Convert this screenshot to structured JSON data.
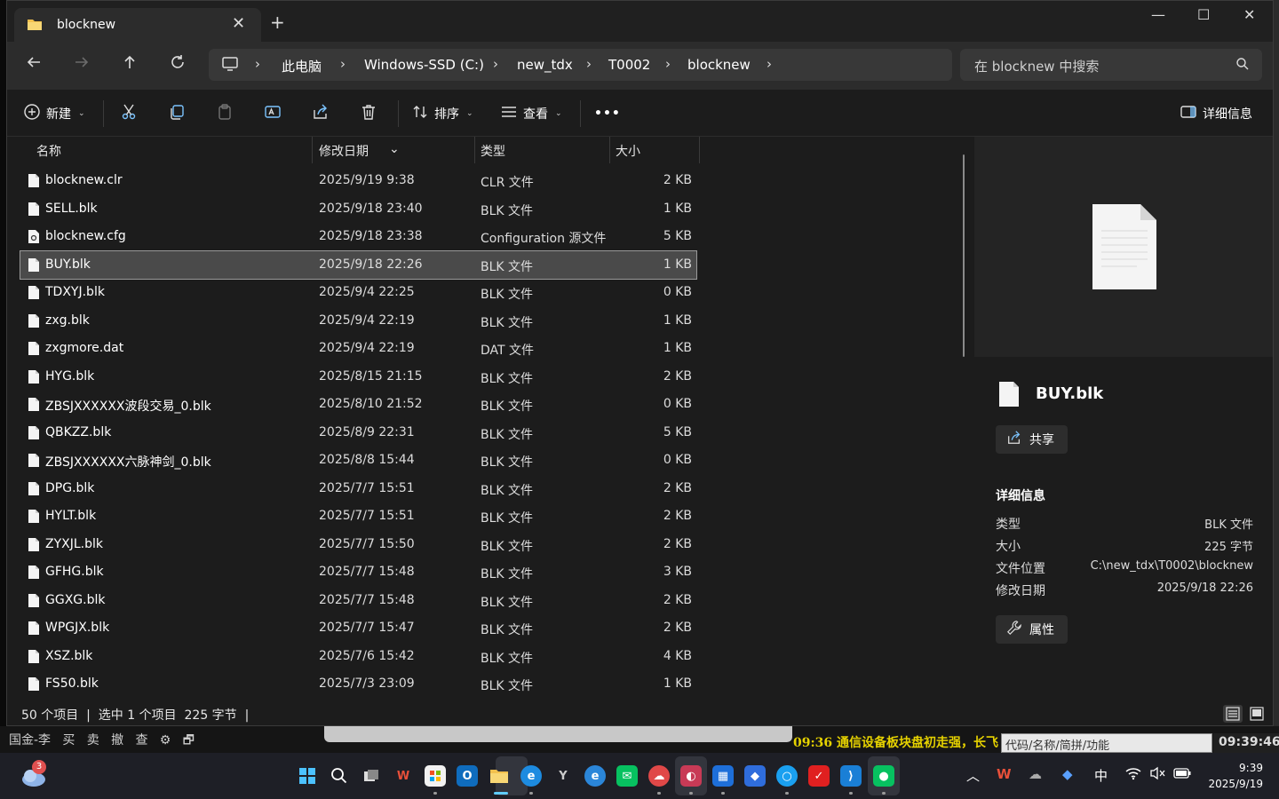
{
  "window": {
    "tab_title": "blocknew",
    "new_tab": "+",
    "controls": {
      "minimize": "—",
      "maximize": "☐",
      "close": "✕"
    }
  },
  "nav": {
    "back_icon": "arrow-left-icon",
    "forward_icon": "arrow-right-icon",
    "up_icon": "arrow-up-icon",
    "refresh_icon": "refresh-icon",
    "breadcrumbs": [
      "此电脑",
      "Windows-SSD (C:)",
      "new_tdx",
      "T0002",
      "blocknew"
    ],
    "search_placeholder": "在 blocknew 中搜索"
  },
  "toolbar": {
    "new_label": "新建",
    "sort_label": "排序",
    "view_label": "查看",
    "more_label": "•••",
    "details_label": "详细信息"
  },
  "columns": {
    "name": "名称",
    "date": "修改日期",
    "type": "类型",
    "size": "大小"
  },
  "files": [
    {
      "name": "blocknew.clr",
      "date": "2025/9/19 9:38",
      "type": "CLR 文件",
      "size": "2 KB",
      "icon": "file-icon"
    },
    {
      "name": "SELL.blk",
      "date": "2025/9/18 23:40",
      "type": "BLK 文件",
      "size": "1 KB",
      "icon": "file-icon"
    },
    {
      "name": "blocknew.cfg",
      "date": "2025/9/18 23:38",
      "type": "Configuration 源文件",
      "size": "5 KB",
      "icon": "config-file-icon"
    },
    {
      "name": "BUY.blk",
      "date": "2025/9/18 22:26",
      "type": "BLK 文件",
      "size": "1 KB",
      "icon": "file-icon",
      "selected": true
    },
    {
      "name": "TDXYJ.blk",
      "date": "2025/9/4 22:25",
      "type": "BLK 文件",
      "size": "0 KB",
      "icon": "file-icon"
    },
    {
      "name": "zxg.blk",
      "date": "2025/9/4 22:19",
      "type": "BLK 文件",
      "size": "1 KB",
      "icon": "file-icon"
    },
    {
      "name": "zxgmore.dat",
      "date": "2025/9/4 22:19",
      "type": "DAT 文件",
      "size": "1 KB",
      "icon": "file-icon"
    },
    {
      "name": "HYG.blk",
      "date": "2025/8/15 21:15",
      "type": "BLK 文件",
      "size": "2 KB",
      "icon": "file-icon"
    },
    {
      "name": "ZBSJXXXXXX波段交易_0.blk",
      "date": "2025/8/10 21:52",
      "type": "BLK 文件",
      "size": "0 KB",
      "icon": "file-icon"
    },
    {
      "name": "QBKZZ.blk",
      "date": "2025/8/9 22:31",
      "type": "BLK 文件",
      "size": "5 KB",
      "icon": "file-icon"
    },
    {
      "name": "ZBSJXXXXXX六脉神剑_0.blk",
      "date": "2025/8/8 15:44",
      "type": "BLK 文件",
      "size": "0 KB",
      "icon": "file-icon"
    },
    {
      "name": "DPG.blk",
      "date": "2025/7/7 15:51",
      "type": "BLK 文件",
      "size": "2 KB",
      "icon": "file-icon"
    },
    {
      "name": "HYLT.blk",
      "date": "2025/7/7 15:51",
      "type": "BLK 文件",
      "size": "2 KB",
      "icon": "file-icon"
    },
    {
      "name": "ZYXJL.blk",
      "date": "2025/7/7 15:50",
      "type": "BLK 文件",
      "size": "2 KB",
      "icon": "file-icon"
    },
    {
      "name": "GFHG.blk",
      "date": "2025/7/7 15:48",
      "type": "BLK 文件",
      "size": "3 KB",
      "icon": "file-icon"
    },
    {
      "name": "GGXG.blk",
      "date": "2025/7/7 15:48",
      "type": "BLK 文件",
      "size": "2 KB",
      "icon": "file-icon"
    },
    {
      "name": "WPGJX.blk",
      "date": "2025/7/7 15:47",
      "type": "BLK 文件",
      "size": "2 KB",
      "icon": "file-icon"
    },
    {
      "name": "XSZ.blk",
      "date": "2025/7/6 15:42",
      "type": "BLK 文件",
      "size": "4 KB",
      "icon": "file-icon"
    },
    {
      "name": "FS50.blk",
      "date": "2025/7/3 23:09",
      "type": "BLK 文件",
      "size": "1 KB",
      "icon": "file-icon"
    }
  ],
  "details": {
    "file_name": "BUY.blk",
    "share_label": "共享",
    "heading": "详细信息",
    "props": [
      {
        "k": "类型",
        "v": "BLK 文件"
      },
      {
        "k": "大小",
        "v": "225 字节"
      },
      {
        "k": "文件位置",
        "v": "C:\\new_tdx\\T0002\\blocknew"
      },
      {
        "k": "修改日期",
        "v": "2025/9/18 22:26"
      }
    ],
    "properties_label": "属性"
  },
  "status": {
    "count": "50 个项目",
    "selection": "选中 1 个项目  225 字节"
  },
  "background_app": {
    "menu": "国金-李   买   卖   撤   查   ⚙   🗗   ",
    "ticker": "09:36 通信设备板块盘初走强，长飞",
    "code_placeholder": "代码/名称/简拼/功能",
    "time": "09:39:46"
  },
  "taskbar": {
    "weather_badge": "3",
    "clock_time": "9:39",
    "clock_date": "2025/9/19",
    "ime": "中"
  },
  "colors": {
    "accent": "#60cdff",
    "selected_row": "#4a4a4a",
    "ticker": "#e6d200"
  }
}
